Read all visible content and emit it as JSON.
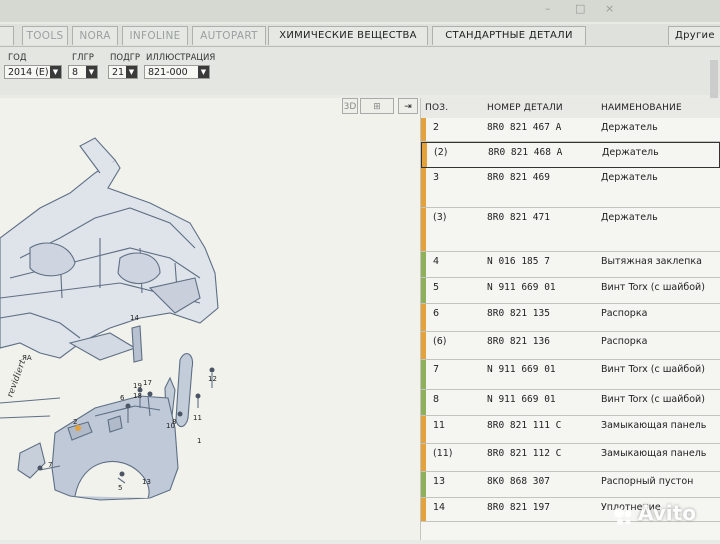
{
  "window": {
    "controls": [
      "–",
      "□",
      "×"
    ]
  },
  "tabs": [
    {
      "label": "TOOLS",
      "state": "inactive"
    },
    {
      "label": "NORA",
      "state": "inactive"
    },
    {
      "label": "INFOLINE",
      "state": "inactive"
    },
    {
      "label": "AUTOPART",
      "state": "inactive"
    },
    {
      "label": "ХИМИЧЕСКИЕ ВЕЩЕСТВА",
      "state": "dark"
    },
    {
      "label": "СТАНДАРТНЫЕ ДЕТАЛИ",
      "state": "dark"
    },
    {
      "label": "Другие",
      "state": "dark"
    }
  ],
  "filters": {
    "year": {
      "label": "ГОД",
      "value": "2014 (E)"
    },
    "group": {
      "label": "ГЛГР",
      "value": "8"
    },
    "subgroup": {
      "label": "ПОДГР",
      "value": "21"
    },
    "illustration": {
      "label": "ИЛЛЮСТРАЦИЯ",
      "value": "821-000"
    }
  },
  "view_buttons": [
    "3D",
    "⊞",
    "⇥"
  ],
  "table": {
    "headers": {
      "pos": "ПОЗ.",
      "part": "НОМЕР ДЕТАЛИ",
      "name": "НАИМЕНОВАНИЕ"
    },
    "rows": [
      {
        "pos": "2",
        "part": "8R0  821  467  A",
        "name": "Держатель",
        "strip": "#e3a23c",
        "selected": false
      },
      {
        "pos": "(2)",
        "part": "8R0  821  468  A",
        "name": "Держатель",
        "strip": "#e3a23c",
        "selected": true
      },
      {
        "pos": "3",
        "part": "8R0  821  469",
        "name": "Держатель",
        "strip": "#e3a23c",
        "selected": false
      },
      {
        "pos": "(3)",
        "part": "8R0  821  471",
        "name": "Держатель",
        "strip": "#e3a23c",
        "selected": false
      },
      {
        "pos": "4",
        "part": "N    016  185  7",
        "name": "Вытяжная заклепка",
        "strip": "#8fb05a",
        "selected": false
      },
      {
        "pos": "5",
        "part": "N    911  669  01",
        "name": "Винт Torx (с шайбой)",
        "strip": "#8fb05a",
        "selected": false
      },
      {
        "pos": "6",
        "part": "8R0  821  135",
        "name": "Распорка",
        "strip": "#e3a23c",
        "selected": false
      },
      {
        "pos": "(6)",
        "part": "8R0  821  136",
        "name": "Распорка",
        "strip": "#e3a23c",
        "selected": false
      },
      {
        "pos": "7",
        "part": "N    911  669  01",
        "name": "Винт Torx (с шайбой)",
        "strip": "#8fb05a",
        "selected": false
      },
      {
        "pos": "8",
        "part": "N    911  669  01",
        "name": "Винт Torx (с шайбой)",
        "strip": "#8fb05a",
        "selected": false
      },
      {
        "pos": "11",
        "part": "8R0  821  111  C",
        "name": "Замыкающая панель",
        "strip": "#e3a23c",
        "selected": false
      },
      {
        "pos": "(11)",
        "part": "8R0  821  112  C",
        "name": "Замыкающая панель",
        "strip": "#e3a23c",
        "selected": false
      },
      {
        "pos": "13",
        "part": "8K0  868  307",
        "name": "Распорный пустон",
        "strip": "#8fb05a",
        "selected": false
      },
      {
        "pos": "14",
        "part": "8R0  821  197",
        "name": "Уплотнение",
        "strip": "#e3a23c",
        "selected": false
      }
    ]
  },
  "diagram": {
    "callouts": [
      "14",
      "17",
      "19",
      "18",
      "12",
      "6",
      "2",
      "11",
      "7",
      "5",
      "10",
      "1",
      "13",
      "8"
    ],
    "sidelabel": "ЯА",
    "stamp": "revidiert"
  },
  "watermark": "Avito"
}
